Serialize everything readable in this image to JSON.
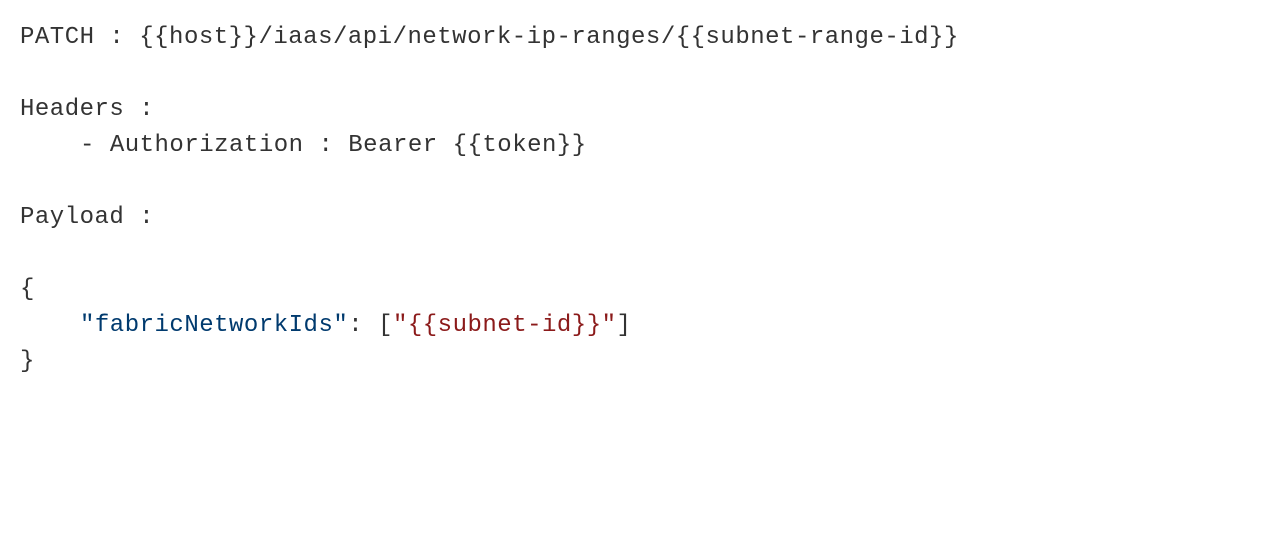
{
  "request": {
    "method": "PATCH",
    "separator": " : ",
    "url": "{{host}}/iaas/api/network-ip-ranges/{{subnet-range-id}}"
  },
  "headers": {
    "label": "Headers :",
    "bullet": "- ",
    "authorization_key": "Authorization",
    "separator": " : ",
    "authorization_value": "Bearer {{token}}"
  },
  "payload": {
    "label": "Payload :",
    "open_brace": "{",
    "close_brace": "}",
    "key_quoted": "\"fabricNetworkIds\"",
    "colon_space": ": ",
    "bracket_open": "[",
    "value_quoted": "\"{{subnet-id}}\"",
    "bracket_close": "]"
  }
}
